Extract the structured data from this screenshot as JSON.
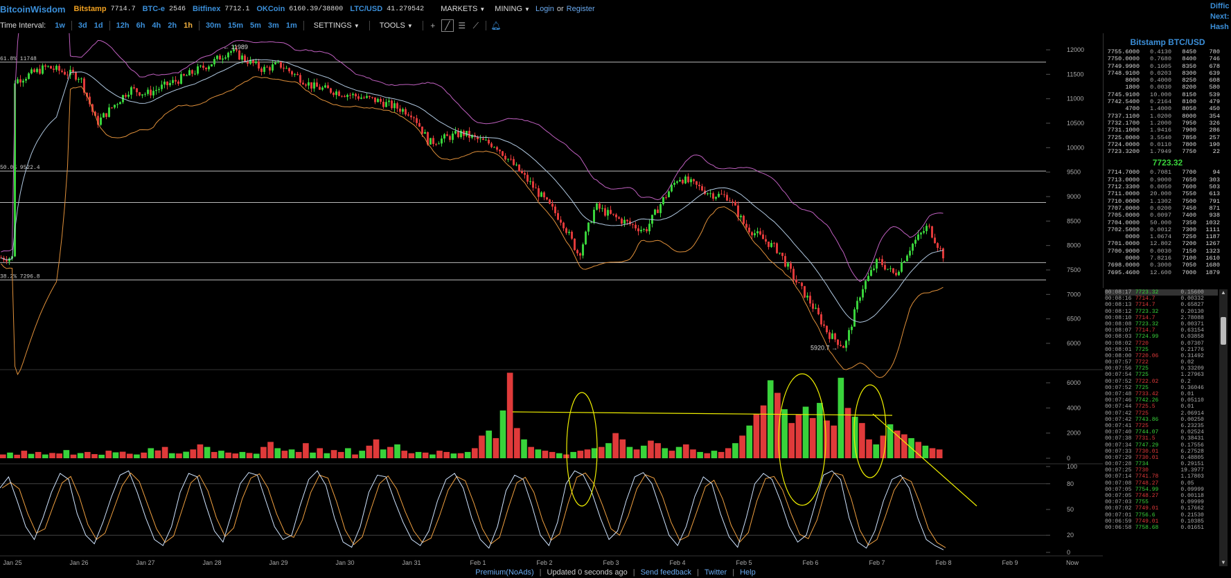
{
  "topbar": {
    "brand": "BitcoinWisdom",
    "exchanges": [
      {
        "name": "Bitstamp",
        "price": "7714.7",
        "color": "#f0a020"
      },
      {
        "name": "BTC-e",
        "price": "2546",
        "color": "#3b8fd9"
      },
      {
        "name": "Bitfinex",
        "price": "7712.1",
        "color": "#3b8fd9"
      },
      {
        "name": "OKCoin",
        "price": "6160.39/38800",
        "color": "#3b8fd9"
      },
      {
        "name": "LTC/USD",
        "price": "41.279542",
        "color": "#3b8fd9"
      }
    ],
    "markets_label": "MARKETS",
    "mining_label": "MINING",
    "login_label": "Login",
    "or_label": "or",
    "register_label": "Register",
    "right_lines": [
      "Diffic",
      "Next:",
      "Hash"
    ]
  },
  "toolbar": {
    "time_interval_label": "Time Interval:",
    "intervals": [
      {
        "label": "1w",
        "active": false
      },
      {
        "label": "3d",
        "active": false
      },
      {
        "label": "1d",
        "active": false
      },
      {
        "label": "12h",
        "active": false
      },
      {
        "label": "6h",
        "active": false
      },
      {
        "label": "4h",
        "active": false
      },
      {
        "label": "2h",
        "active": false
      },
      {
        "label": "1h",
        "active": true
      },
      {
        "label": "30m",
        "active": false
      },
      {
        "label": "15m",
        "active": false
      },
      {
        "label": "5m",
        "active": false
      },
      {
        "label": "3m",
        "active": false
      },
      {
        "label": "1m",
        "active": false
      }
    ],
    "settings_label": "SETTINGS",
    "tools_label": "TOOLS",
    "tool_icons": [
      "crosshair-icon",
      "line-tool-icon",
      "parallel-lines-icon",
      "fib-tool-icon",
      "alert-bell-icon"
    ]
  },
  "chart_data": {
    "type": "candlestick",
    "title": "",
    "price_axis": [
      "12000",
      "11500",
      "11000",
      "10500",
      "10000",
      "9500",
      "9000",
      "8500",
      "8000",
      "7500",
      "7000",
      "6500",
      "6000"
    ],
    "volume_axis": [
      "6000",
      "4000",
      "2000",
      "0"
    ],
    "stoch_axis": [
      "100",
      "80",
      "50",
      "20",
      "0"
    ],
    "x_labels": [
      "Jan 25",
      "Jan 26",
      "Jan 27",
      "Jan 28",
      "Jan 29",
      "Jan 30",
      "Jan 31",
      "Feb 1",
      "Feb 2",
      "Feb 3",
      "Feb 4",
      "Feb 5",
      "Feb 6",
      "Feb 7",
      "Feb 8",
      "Feb 9",
      "Now"
    ],
    "annotations": {
      "high": "11989",
      "low": "5920.7",
      "fib_618": "61.8% 11748",
      "fib_500": "50.0% 9522.4",
      "fib_382": "38.2% 7296.8"
    },
    "horizontal_lines": [
      11748,
      9522.4,
      8880,
      7650,
      7296.8
    ],
    "close_path": [
      [
        "Jan 25",
        11350
      ],
      [
        "Jan 25 12:00",
        11650
      ],
      [
        "Jan 26",
        11450
      ],
      [
        "Jan 26 06:00",
        10500
      ],
      [
        "Jan 26 18:00",
        11200
      ],
      [
        "Jan 27",
        11100
      ],
      [
        "Jan 27 12:00",
        11400
      ],
      [
        "Jan 28",
        11750
      ],
      [
        "Jan 28 06:00",
        11989
      ],
      [
        "Jan 28 18:00",
        11600
      ],
      [
        "Jan 29",
        11700
      ],
      [
        "Jan 29 12:00",
        11250
      ],
      [
        "Jan 30",
        11100
      ],
      [
        "Jan 30 12:00",
        10950
      ],
      [
        "Jan 31",
        10700
      ],
      [
        "Jan 31 06:00",
        10100
      ],
      [
        "Jan 31 18:00",
        10300
      ],
      [
        "Feb 1",
        10150
      ],
      [
        "Feb 1 06:00",
        10050
      ],
      [
        "Feb 1 18:00",
        9300
      ],
      [
        "Feb 2",
        8900
      ],
      [
        "Feb 2 06:00",
        8500
      ],
      [
        "Feb 2 12:00",
        7800
      ],
      [
        "Feb 2 18:00",
        8800
      ],
      [
        "Feb 3",
        8600
      ],
      [
        "Feb 3 12:00",
        8300
      ],
      [
        "Feb 3 18:00",
        8900
      ],
      [
        "Feb 4",
        9400
      ],
      [
        "Feb 4 12:00",
        9050
      ],
      [
        "Feb 4 18:00",
        9000
      ],
      [
        "Feb 5",
        8400
      ],
      [
        "Feb 5 12:00",
        7900
      ],
      [
        "Feb 5 18:00",
        7300
      ],
      [
        "Feb 6",
        6800
      ],
      [
        "Feb 6 06:00",
        6200
      ],
      [
        "Feb 6 12:00",
        5920.7
      ],
      [
        "Feb 6 18:00",
        7100
      ],
      [
        "Feb 7",
        7700
      ],
      [
        "Feb 7 06:00",
        7400
      ],
      [
        "Feb 7 12:00",
        8000
      ],
      [
        "Feb 7 18:00",
        8400
      ],
      [
        "Feb 8",
        7750
      ]
    ],
    "volume_values": [
      300,
      450,
      280,
      600,
      350,
      500,
      300,
      420,
      380,
      650,
      290,
      410,
      500,
      330,
      280,
      600,
      470,
      520,
      360,
      300,
      450,
      800,
      620,
      900,
      400,
      380,
      520,
      700,
      1100,
      900,
      500,
      600,
      450,
      380,
      500,
      420,
      360,
      900,
      1300,
      800,
      600,
      700,
      500,
      1200,
      450,
      800,
      400,
      650,
      500,
      800,
      300,
      600,
      1000,
      1500,
      700,
      900,
      1100,
      600,
      400,
      500,
      450,
      300,
      600,
      500,
      380,
      400,
      500,
      800,
      1800,
      2200,
      1600,
      3800,
      6800,
      2400,
      1500,
      900,
      700,
      600,
      500,
      400,
      300,
      500,
      600,
      700,
      800,
      900,
      1200,
      2000,
      1500,
      900,
      700,
      1000,
      1400,
      1200,
      800,
      600,
      900,
      1100,
      700,
      500,
      400,
      600,
      500,
      800,
      1200,
      1800,
      2600,
      3500,
      4200,
      6200,
      5200,
      3900,
      2800,
      3500,
      4100,
      3200,
      4400,
      3000,
      2600,
      6400,
      4000,
      3300,
      2800,
      1500,
      1100,
      1800,
      2700,
      2200,
      1900,
      1600,
      1300,
      1000,
      800,
      700
    ],
    "stoch_values": [
      75,
      88,
      60,
      30,
      15,
      40,
      70,
      92,
      85,
      45,
      20,
      10,
      35,
      65,
      90,
      95,
      70,
      40,
      15,
      8,
      30,
      70,
      92,
      88,
      55,
      25,
      12,
      45,
      80,
      93,
      90,
      60,
      30,
      15,
      20,
      55,
      85,
      95,
      78,
      40,
      12,
      6,
      30,
      70,
      90,
      88,
      60,
      35,
      15,
      8,
      25,
      60,
      85,
      92,
      75,
      40,
      15,
      5,
      30,
      72,
      90,
      85,
      55,
      20,
      8,
      35,
      80,
      95,
      90,
      70,
      40,
      15,
      25,
      60,
      88,
      93,
      80,
      50,
      20,
      8,
      30,
      65,
      88,
      80,
      45,
      18,
      6,
      40,
      80,
      92,
      85,
      60,
      30,
      12,
      20,
      55,
      90,
      95,
      85,
      40,
      12,
      5,
      25,
      60,
      85,
      90,
      75,
      40,
      15,
      8,
      3
    ]
  },
  "orderbook": {
    "title": "Bitstamp BTC/USD",
    "asks": [
      [
        "7755.6000",
        "0.4130",
        "8450",
        "780"
      ],
      [
        "7750.0000",
        "0.7680",
        "8400",
        "746"
      ],
      [
        "7749.9900",
        "0.1605",
        "8350",
        "678"
      ],
      [
        "7748.9100",
        "0.0203",
        "8300",
        "639"
      ],
      [
        "8000",
        "0.4000",
        "8250",
        "608"
      ],
      [
        "1800",
        "0.0030",
        "8200",
        "580"
      ],
      [
        "7745.9100",
        "10.000",
        "8150",
        "539"
      ],
      [
        "7742.5400",
        "0.2164",
        "8100",
        "479"
      ],
      [
        "4700",
        "1.4000",
        "8050",
        "450"
      ],
      [
        "7737.1100",
        "1.0200",
        "8000",
        "354"
      ],
      [
        "7732.1700",
        "1.2000",
        "7950",
        "326"
      ],
      [
        "7731.1000",
        "1.9416",
        "7900",
        "286"
      ],
      [
        "7725.0000",
        "3.5540",
        "7850",
        "257"
      ],
      [
        "7724.0000",
        "0.0110",
        "7800",
        "190"
      ],
      [
        "7723.3200",
        "1.7949",
        "7750",
        "22"
      ]
    ],
    "last_price": "7723.32",
    "bids": [
      [
        "7714.7000",
        "0.7081",
        "7700",
        "94"
      ],
      [
        "7713.0000",
        "0.9000",
        "7650",
        "303"
      ],
      [
        "7712.3300",
        "0.0050",
        "7600",
        "503"
      ],
      [
        "7711.0000",
        "20.000",
        "7550",
        "613"
      ],
      [
        "7710.0000",
        "1.1302",
        "7500",
        "791"
      ],
      [
        "7707.0000",
        "0.0200",
        "7450",
        "871"
      ],
      [
        "7705.0000",
        "0.0097",
        "7400",
        "938"
      ],
      [
        "7704.0000",
        "50.000",
        "7350",
        "1032"
      ],
      [
        "7702.5000",
        "0.0012",
        "7300",
        "1111"
      ],
      [
        "0000",
        "1.0674",
        "7250",
        "1187"
      ],
      [
        "7701.0000",
        "12.802",
        "7200",
        "1267"
      ],
      [
        "7700.9000",
        "0.0030",
        "7150",
        "1323"
      ],
      [
        "0000",
        "7.8216",
        "7100",
        "1610"
      ],
      [
        "7698.0000",
        "0.3000",
        "7050",
        "1680"
      ],
      [
        "7695.4600",
        "12.600",
        "7000",
        "1879"
      ]
    ]
  },
  "trades": [
    [
      "00:08:17",
      "7723.32",
      "0.15600",
      "g"
    ],
    [
      "00:08:16",
      "7714.7",
      "0.00332",
      "r"
    ],
    [
      "00:08:13",
      "7714.7",
      "0.65827",
      "r"
    ],
    [
      "00:08:12",
      "7723.32",
      "0.20130",
      "g"
    ],
    [
      "00:08:10",
      "7714.7",
      "2.78088",
      "r"
    ],
    [
      "00:08:08",
      "7723.32",
      "0.00371",
      "g"
    ],
    [
      "00:08:07",
      "7714.7",
      "0.63154",
      "r"
    ],
    [
      "00:08:03",
      "7724.99",
      "0.03858",
      "g"
    ],
    [
      "00:08:02",
      "7720",
      "0.07307",
      "r"
    ],
    [
      "00:08:01",
      "7725",
      "0.21776",
      "g"
    ],
    [
      "00:08:00",
      "7720.06",
      "0.31492",
      "r"
    ],
    [
      "00:07:57",
      "7722",
      "0.02",
      "r"
    ],
    [
      "00:07:56",
      "7725",
      "0.33209",
      "g"
    ],
    [
      "00:07:54",
      "7725",
      "1.27963",
      "g"
    ],
    [
      "00:07:52",
      "7722.02",
      "0.2",
      "r"
    ],
    [
      "00:07:52",
      "7725",
      "0.36046",
      "g"
    ],
    [
      "00:07:48",
      "7733.42",
      "0.01",
      "r"
    ],
    [
      "00:07:46",
      "7742.26",
      "0.05110",
      "g"
    ],
    [
      "00:07:44",
      "7725.5",
      "0.01",
      "r"
    ],
    [
      "00:07:42",
      "7725",
      "2.06914",
      "r"
    ],
    [
      "00:07:42",
      "7743.86",
      "0.00250",
      "g"
    ],
    [
      "00:07:41",
      "7725",
      "6.23235",
      "r"
    ],
    [
      "00:07:40",
      "7744.07",
      "0.02524",
      "g"
    ],
    [
      "00:07:38",
      "7731.5",
      "0.38431",
      "r"
    ],
    [
      "00:07:34",
      "7747.29",
      "0.17556",
      "g"
    ],
    [
      "00:07:33",
      "7730.01",
      "6.27528",
      "r"
    ],
    [
      "00:07:29",
      "7730.01",
      "0.48805",
      "r"
    ],
    [
      "00:07:28",
      "7734",
      "0.29151",
      "g"
    ],
    [
      "00:07:25",
      "7730",
      "19.3977",
      "r"
    ],
    [
      "00:07:14",
      "7741.78",
      "1.17803",
      "r"
    ],
    [
      "00:07:08",
      "7748.27",
      "0.05",
      "r"
    ],
    [
      "00:07:05",
      "7754.99",
      "0.09999",
      "g"
    ],
    [
      "00:07:05",
      "7748.27",
      "0.00118",
      "r"
    ],
    [
      "00:07:03",
      "7755",
      "0.09999",
      "g"
    ],
    [
      "00:07:02",
      "7749.01",
      "0.17662",
      "r"
    ],
    [
      "00:07:01",
      "7756.6",
      "0.21530",
      "g"
    ],
    [
      "00:06:59",
      "7749.01",
      "0.10385",
      "r"
    ],
    [
      "00:06:58",
      "7758.68",
      "0.01651",
      "g"
    ]
  ],
  "footer": {
    "premium_label": "Premium(NoAds)",
    "updated_label": "Updated 0 seconds ago",
    "feedback_label": "Send feedback",
    "twitter_label": "Twitter",
    "help_label": "Help"
  },
  "colors": {
    "up": "#39d33b",
    "down": "#e03a3a",
    "upper_band": "#c060c0",
    "lower_band": "#e0903a",
    "middle_band": "#b0c8e0",
    "stoch_k": "#cfe4ff",
    "stoch_d": "#f0a040",
    "annotation": "#f0f000"
  }
}
